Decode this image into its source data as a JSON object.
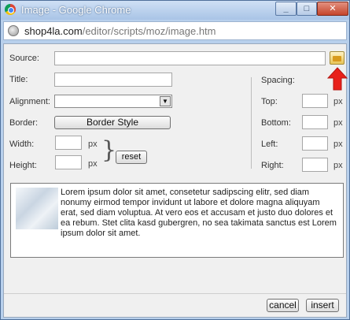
{
  "window": {
    "title": "Image - Google Chrome",
    "controls": {
      "minimize": "_",
      "maximize": "□",
      "close": "✕"
    }
  },
  "address_bar": {
    "url_host": "shop4la.com",
    "url_path": "/editor/scripts/moz/image.htm"
  },
  "form": {
    "source_label": "Source:",
    "source_value": "",
    "title_label": "Title:",
    "title_value": "",
    "alignment_label": "Alignment:",
    "alignment_value": "",
    "border_label": "Border:",
    "border_style_button": "Border Style",
    "width_label": "Width:",
    "width_value": "",
    "height_label": "Height:",
    "height_value": "",
    "unit": "px",
    "reset_button": "reset",
    "brace_glyph": "}",
    "spacing_label": "Spacing:",
    "top_label": "Top:",
    "top_value": "",
    "bottom_label": "Bottom:",
    "bottom_value": "",
    "left_label": "Left:",
    "left_value": "",
    "right_label": "Right:",
    "right_value": "",
    "select_arrow_glyph": "▼"
  },
  "preview": {
    "text": "Lorem ipsum dolor sit amet, consetetur sadipscing elitr, sed diam nonumy eirmod tempor invidunt ut labore et dolore magna aliquyam erat, sed diam voluptua. At vero eos et accusam et justo duo dolores et ea rebum. Stet clita kasd gubergren, no sea takimata sanctus est Lorem ipsum dolor sit amet."
  },
  "buttons": {
    "cancel": "cancel",
    "insert": "insert"
  },
  "colors": {
    "annotation_arrow": "#e8201a",
    "window_frame": "#b8d0ec"
  },
  "icons": [
    "chrome-logo-icon",
    "globe-icon",
    "folder-icon",
    "red-arrow-icon"
  ]
}
